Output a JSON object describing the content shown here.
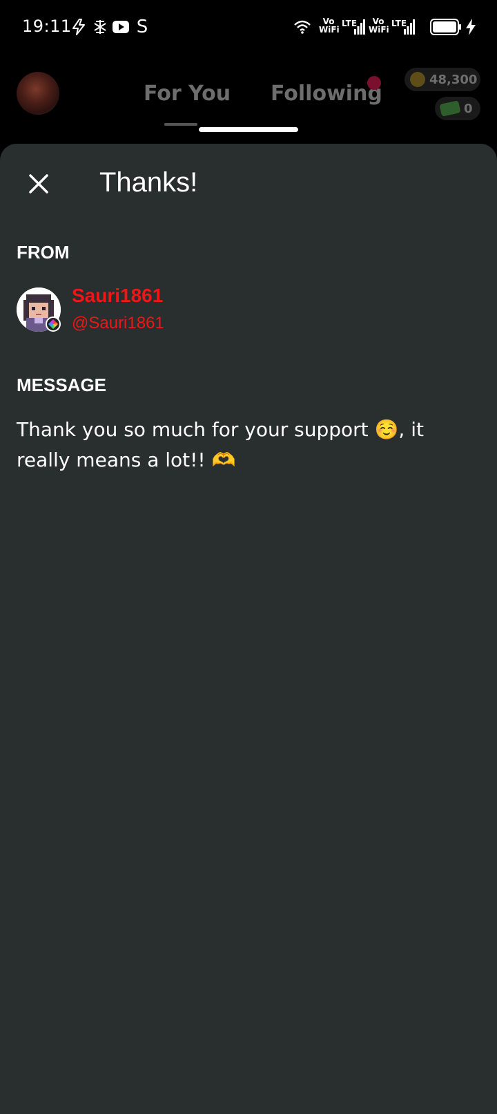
{
  "status_bar": {
    "time": "19:11",
    "app_icons": [
      "bolt-icon",
      "app-sparkle-icon",
      "youtube-icon",
      "s-icon"
    ],
    "s_glyph": "S",
    "vowifi_1": "Vo\nWiFi",
    "lte_1": "LTE",
    "vowifi_2": "Vo\nWiFi",
    "lte_2": "LTE"
  },
  "header": {
    "tabs": [
      {
        "label": "For You",
        "selected": true
      },
      {
        "label": "Following",
        "selected": false
      }
    ],
    "coins": "48,300",
    "cash": "0",
    "notification_dot_color": "#7a0f2e"
  },
  "sheet": {
    "title": "Thanks!",
    "from_label": "FROM",
    "sender": {
      "display_name": "Sauri1861",
      "handle": "@Sauri1861",
      "name_color": "#f01616"
    },
    "message_label": "MESSAGE",
    "message": "Thank you so much for your support ☺️, it really means a lot!! 🫶"
  },
  "colors": {
    "sheet_bg": "#292e2f",
    "page_bg": "#000000"
  }
}
